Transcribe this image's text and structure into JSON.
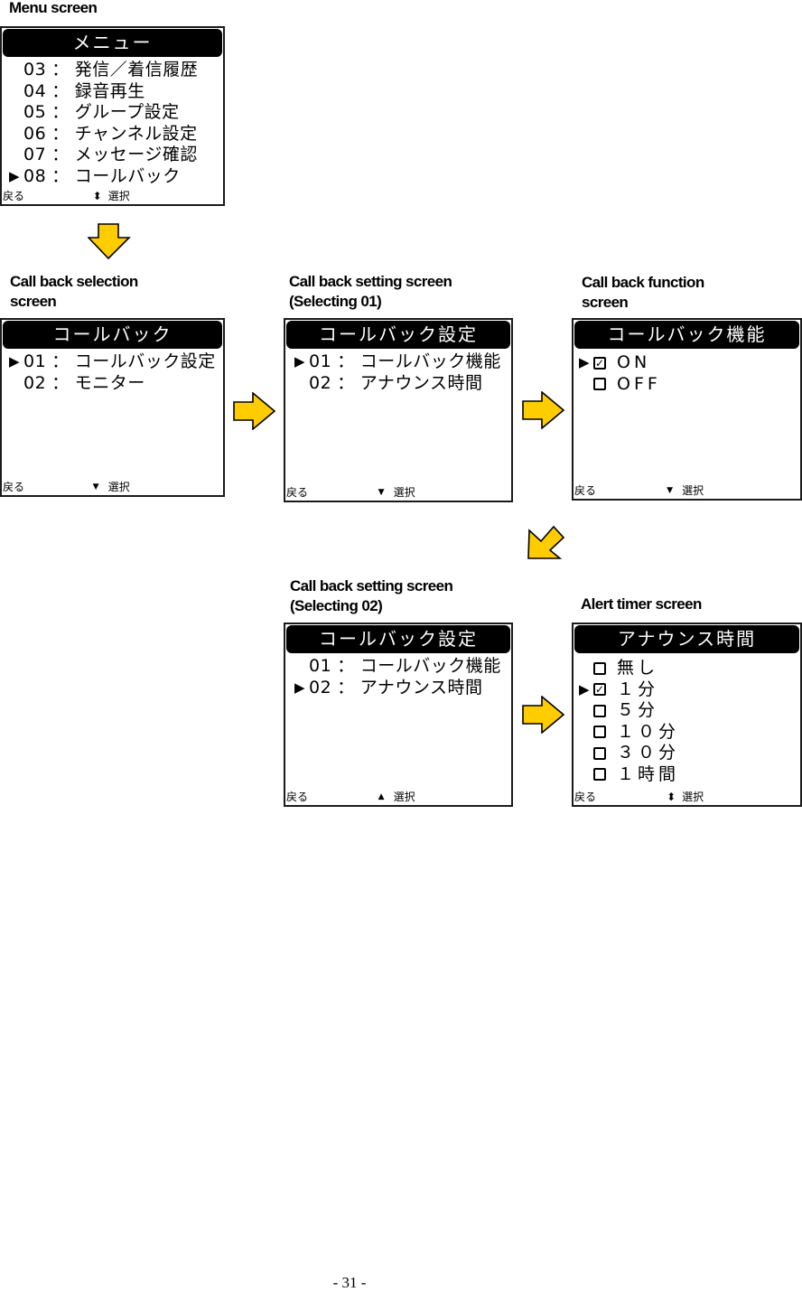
{
  "captions": {
    "menu": "Menu screen",
    "callback_selection": "Call back selection\nscreen",
    "callback_setting_01": "Call back setting screen\n(Selecting 01)",
    "callback_function": "Call back function\nscreen",
    "callback_setting_02": "Call back setting screen\n(Selecting 02)",
    "alert_timer": "Alert timer screen"
  },
  "softkeys": {
    "back": "戻る",
    "select": "選択",
    "arrow_updown": "⬍",
    "arrow_down": "▼",
    "arrow_up": "▲"
  },
  "screens": {
    "menu": {
      "title": "メニュー",
      "items": [
        {
          "num": "03",
          "label": "発信／着信履歴",
          "selected": false
        },
        {
          "num": "04",
          "label": "録音再生",
          "selected": false
        },
        {
          "num": "05",
          "label": "グループ設定",
          "selected": false
        },
        {
          "num": "06",
          "label": "チャンネル設定",
          "selected": false
        },
        {
          "num": "07",
          "label": "メッセージ確認",
          "selected": false
        },
        {
          "num": "08",
          "label": "コールバック",
          "selected": true
        }
      ],
      "nav": "up-down"
    },
    "callback_selection": {
      "title": "コールバック",
      "items": [
        {
          "num": "01",
          "label": "コールバック設定",
          "selected": true
        },
        {
          "num": "02",
          "label": "モニター",
          "selected": false
        }
      ],
      "nav": "down"
    },
    "callback_setting_01": {
      "title": "コールバック設定",
      "items": [
        {
          "num": "01",
          "label": "コールバック機能",
          "selected": true
        },
        {
          "num": "02",
          "label": "アナウンス時間",
          "selected": false
        }
      ],
      "nav": "down"
    },
    "callback_function": {
      "title": "コールバック機能",
      "options": [
        {
          "label": "ON",
          "checked": true,
          "selected": true
        },
        {
          "label": "OFF",
          "checked": false,
          "selected": false
        }
      ],
      "nav": "down"
    },
    "callback_setting_02": {
      "title": "コールバック設定",
      "items": [
        {
          "num": "01",
          "label": "コールバック機能",
          "selected": false
        },
        {
          "num": "02",
          "label": "アナウンス時間",
          "selected": true
        }
      ],
      "nav": "up"
    },
    "alert_timer": {
      "title": "アナウンス時間",
      "options": [
        {
          "label": "無し",
          "checked": false,
          "selected": false
        },
        {
          "label": "１分",
          "checked": true,
          "selected": true
        },
        {
          "label": "５分",
          "checked": false,
          "selected": false
        },
        {
          "label": "１０分",
          "checked": false,
          "selected": false
        },
        {
          "label": "３０分",
          "checked": false,
          "selected": false
        },
        {
          "label": "１時間",
          "checked": false,
          "selected": false
        }
      ],
      "nav": "up-down"
    }
  },
  "symbols": {
    "cursor": "▶",
    "check": "✓",
    "separator": "："
  },
  "colors": {
    "arrow_fill": "#FFCC00",
    "arrow_stroke": "#000000",
    "titlebar_bg": "#000000",
    "titlebar_text": "#FFFFFF"
  },
  "page_number": "- 31 -"
}
